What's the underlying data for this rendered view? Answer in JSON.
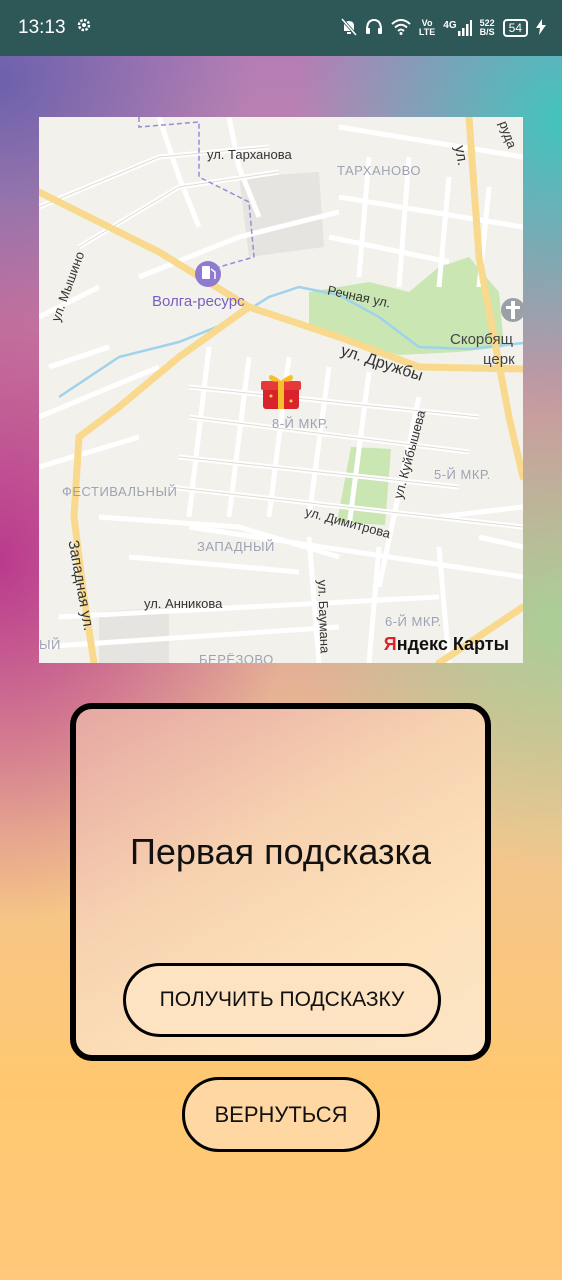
{
  "status_bar": {
    "time": "13:13",
    "settings_icon": "gear-icon",
    "volte_top": "Vo",
    "volte_bottom": "LTE",
    "network": "4G",
    "speed_top": "522",
    "speed_bottom": "B/S",
    "battery": "54"
  },
  "map": {
    "streets": {
      "tarkhanova": "ул. Тарханова",
      "mishino": "ул. Мышино",
      "rechnaya": "Речная ул.",
      "druzhby": "ул. Дружбы",
      "kuibysheva": "ул. Куйбышева",
      "dimitrova": "ул. Димитрова",
      "zapadnaya": "Западная ул.",
      "annikova": "ул. Анникова",
      "baumana": "ул. Баумана",
      "ul_right": "ул.",
      "ruda": "руда"
    },
    "districts": {
      "tarkhanovo": "ТАРХАНОВО",
      "mkr8": "8-Й МКР.",
      "mkr5": "5-Й МКР.",
      "festivalny": "ФЕСТИВАЛЬНЫЙ",
      "zapadny": "ЗАПАДНЫЙ",
      "mkr6": "6-Й МКР.",
      "berezovo": "БЕРЁЗОВО",
      "ly": "ЫЙ"
    },
    "pois": {
      "volga": "Волга-ресурс",
      "church_1": "Скорбящ",
      "church_2": "церк"
    },
    "brand_y": "Я",
    "brand_rest": "ндекс Карты"
  },
  "card": {
    "title": "Первая подсказка",
    "hint_button": "ПОЛУЧИТЬ ПОДСКАЗКУ"
  },
  "back_button": "ВЕРНУТЬСЯ"
}
